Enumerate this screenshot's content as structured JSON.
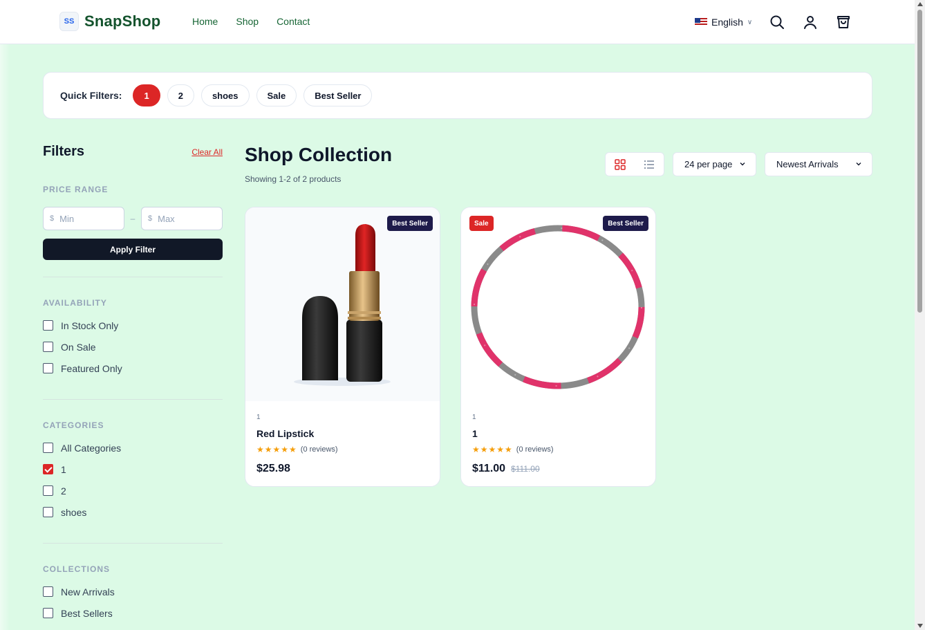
{
  "header": {
    "brand": "SnapShop",
    "logo_mark": "SS",
    "nav": [
      "Home",
      "Shop",
      "Contact"
    ],
    "language": "English",
    "icons": [
      "search-icon",
      "user-icon",
      "cart-icon"
    ]
  },
  "quick_filters": {
    "label": "Quick Filters:",
    "chips": [
      "1",
      "2",
      "shoes",
      "Sale",
      "Best Seller"
    ],
    "active_index": 0
  },
  "sidebar": {
    "title": "Filters",
    "clear_all": "Clear All",
    "price_range": {
      "heading": "PRICE RANGE",
      "currency": "$",
      "min_placeholder": "Min",
      "max_placeholder": "Max",
      "separator": "–",
      "apply": "Apply Filter"
    },
    "availability": {
      "heading": "AVAILABILITY",
      "items": [
        {
          "label": "In Stock Only",
          "checked": false
        },
        {
          "label": "On Sale",
          "checked": false
        },
        {
          "label": "Featured Only",
          "checked": false
        }
      ]
    },
    "categories": {
      "heading": "CATEGORIES",
      "items": [
        {
          "label": "All Categories",
          "checked": false
        },
        {
          "label": "1",
          "checked": true
        },
        {
          "label": "2",
          "checked": false
        },
        {
          "label": "shoes",
          "checked": false
        }
      ]
    },
    "collections": {
      "heading": "COLLECTIONS",
      "items": [
        {
          "label": "New Arrivals",
          "checked": false
        },
        {
          "label": "Best Sellers",
          "checked": false
        }
      ]
    }
  },
  "main": {
    "title": "Shop Collection",
    "showing": "Showing 1-2 of 2 products",
    "per_page": "24 per page",
    "sort": "Newest Arrivals"
  },
  "products": [
    {
      "category": "1",
      "name": "Red Lipstick",
      "stars": "★★★★★",
      "reviews": "(0 reviews)",
      "price": "$25.98",
      "old_price": "",
      "badges": [
        "Best Seller"
      ],
      "image": "lipstick"
    },
    {
      "category": "1",
      "name": "1",
      "stars": "★★★★★",
      "reviews": "(0 reviews)",
      "price": "$11.00",
      "old_price": "$111.00",
      "badges": [
        "Sale",
        "Best Seller"
      ],
      "image": "hula-hoop"
    }
  ],
  "colors": {
    "background": "#dcfae6",
    "accent": "#dc2626",
    "brand_green": "#14532d",
    "dark": "#111827",
    "badge_navy": "#1e1b4b",
    "star": "#f59e0b"
  }
}
